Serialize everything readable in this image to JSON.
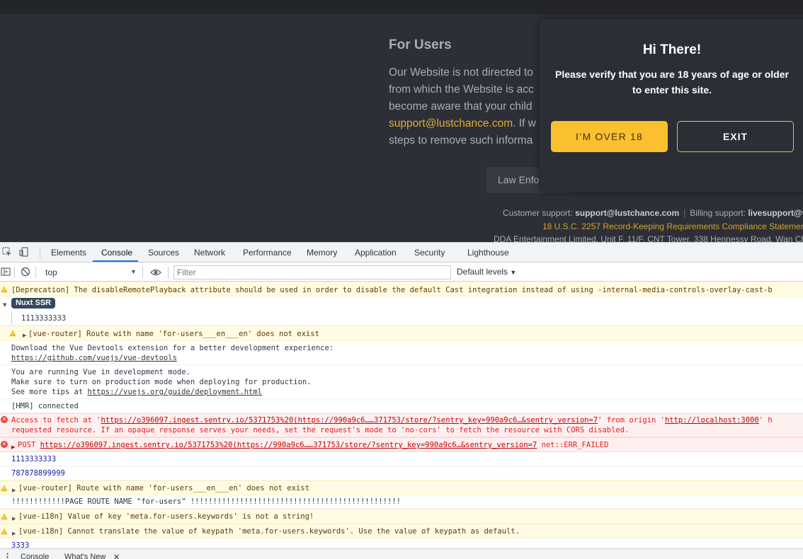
{
  "site": {
    "section_title": "For Users",
    "policy_lines": [
      "Our Website is not directed to",
      "from which the Website is acc",
      "become aware that your child",
      "steps to remove such informa"
    ],
    "policy_email": "support@lustchance.com",
    "policy_after_email": ". If w",
    "law_button": "Law Enfor",
    "footer": {
      "customer_label": "Customer support:",
      "customer_email": "support@lustchance.com",
      "billing_label": "Billing support:",
      "billing_email": "livesupport@ve",
      "statement": "18 U.S.C. 2257 Record-Keeping Requirements Compliance Statement",
      "address": "DDA Entertainment Limited, Unit F, 11/F, CNT Tower, 338 Hennessy Road, Wan Cha"
    },
    "colors": {
      "background": "#2d2f36",
      "accent": "#fbc02d",
      "link": "#e0ad2e"
    }
  },
  "modal": {
    "title": "Hi There!",
    "message": "Please verify that you are 18 years of age or older to enter this site.",
    "confirm_label": "I’M OVER 18",
    "exit_label": "EXIT"
  },
  "devtools": {
    "tabs": [
      "Elements",
      "Console",
      "Sources",
      "Network",
      "Performance",
      "Memory",
      "Application",
      "Security",
      "Lighthouse"
    ],
    "active_tab": "Console",
    "context": "top",
    "filter_placeholder": "Filter",
    "levels": "Default levels",
    "drawer_tabs": [
      "Console",
      "What's New"
    ],
    "messages": {
      "deprecation": "[Deprecation] The disableRemotePlayback attribute should be used in order to disable the default Cast integration instead of using -internal-media-controls-overlay-cast-b",
      "nuxt_badge": "Nuxt SSR",
      "ssr_value": "1113333333",
      "router_warn_1": "[vue-router] Route with name 'for-users___en___en' does not exist",
      "devtools_1": "Download the Vue Devtools extension for a better development experience:",
      "devtools_link": "https://github.com/vuejs/vue-devtools",
      "devmode_1": "You are running Vue in development mode.",
      "devmode_2": "Make sure to turn on production mode when deploying for production.",
      "devmode_3": "See more tips at",
      "devmode_link": "https://vuejs.org/guide/deployment.html",
      "hmr": "[HMR] connected",
      "cors_1a": "Access to fetch at '",
      "cors_url": "https://o396097.ingest.sentry.io/5371753%20(https://990a9c6……371753/store/?sentry_key=990a9c6…&sentry_version=7",
      "cors_1b": "' from origin '",
      "cors_origin": "http://localhost:3000",
      "cors_1c": "' h",
      "cors_2": "requested resource. If an opaque response serves your needs, set the request's mode to 'no-cors' to fetch the resource with CORS disabled.",
      "post_method": "POST",
      "post_url": "https://o396097.ingest.sentry.io/5371753%20(https://990a9c6……371753/store/?sentry_key=990a9c6…&sentry_version=7",
      "post_error": "net::ERR_FAILED",
      "value_1": "1113333333",
      "value_2": "787878899999",
      "router_warn_2": "[vue-router] Route with name 'for-users___en___en' does not exist",
      "page_route": "!!!!!!!!!!!!PAGE ROUTE NAME \"for-users\" !!!!!!!!!!!!!!!!!!!!!!!!!!!!!!!!!!!!!!!!!!!!!!!",
      "i18n_warn_1": "[vue-i18n] Value of key 'meta.for-users.keywords' is not a string!",
      "i18n_warn_2": "[vue-i18n] Cannot translate the value of keypath 'meta.for-users.keywords'. Use the value of keypath as default.",
      "value_3": "3333"
    }
  }
}
